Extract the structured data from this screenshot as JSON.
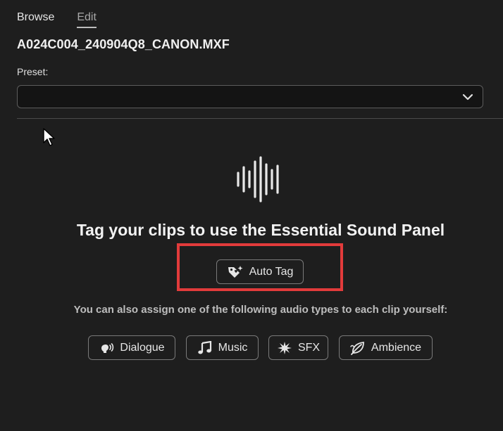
{
  "tabs": [
    {
      "label": "Browse",
      "active": false
    },
    {
      "label": "Edit",
      "active": true
    }
  ],
  "clip_name": "A024C004_240904Q8_CANON.MXF",
  "preset": {
    "label": "Preset:",
    "value": ""
  },
  "heading": "Tag your clips to use the Essential Sound Panel",
  "auto_tag": {
    "label": "Auto Tag",
    "icon": "auto-tag-icon"
  },
  "subtext": "You can also assign one of the following audio types to each clip yourself:",
  "audio_types": [
    {
      "label": "Dialogue",
      "icon": "dialogue-icon"
    },
    {
      "label": "Music",
      "icon": "music-note-icon"
    },
    {
      "label": "SFX",
      "icon": "sfx-burst-icon"
    },
    {
      "label": "Ambience",
      "icon": "ambience-leaf-icon"
    }
  ],
  "colors": {
    "background": "#1e1e1e",
    "highlight": "#e23b3b",
    "border": "#7a7a7a"
  }
}
